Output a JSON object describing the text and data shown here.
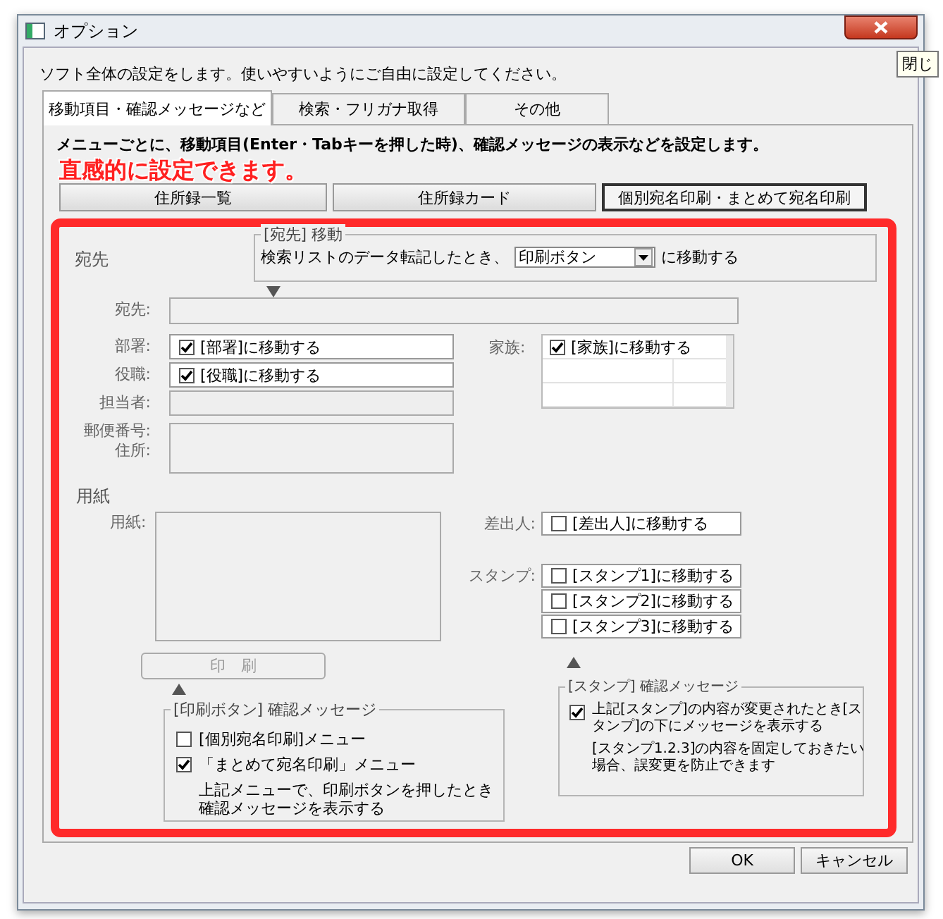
{
  "window": {
    "title": "オプション",
    "tooltip": "閉じ"
  },
  "intro": "ソフト全体の設定をします。使いやすいようにご自由に設定してください。",
  "tabs": [
    {
      "label": "移動項目・確認メッセージなど",
      "selected": true
    },
    {
      "label": "検索・フリガナ取得",
      "selected": false
    },
    {
      "label": "その他",
      "selected": false
    }
  ],
  "description": "メニューごとに、移動項目(Enter・Tabキーを押した時)、確認メッセージの表示などを設定します。",
  "annotation": "直感的に設定できます。",
  "menu_buttons": [
    {
      "label": "住所録一覧",
      "selected": false
    },
    {
      "label": "住所録カード",
      "selected": false
    },
    {
      "label": "個別宛名印刷・まとめて宛名印刷",
      "selected": true
    }
  ],
  "address": {
    "heading": "宛先",
    "move_group": {
      "legend": "[宛先] 移動",
      "prefix": "検索リストのデータ転記したとき、",
      "dropdown": "印刷ボタン",
      "suffix": "に移動する"
    },
    "fields": [
      {
        "labels": [
          "宛先:"
        ],
        "kind": "wide"
      },
      {
        "labels": [
          "部署:"
        ],
        "kind": "check",
        "checked": true,
        "text": "[部署]に移動する"
      },
      {
        "labels": [
          "役職:"
        ],
        "kind": "check",
        "checked": true,
        "text": "[役職]に移動する"
      },
      {
        "labels": [
          "担当者:"
        ],
        "kind": "disabled"
      },
      {
        "labels": [
          "郵便番号:",
          "住所:"
        ],
        "kind": "area"
      }
    ],
    "family": {
      "label": "家族:",
      "checked": true,
      "text": "[家族]に移動する"
    }
  },
  "paper": {
    "heading": "用紙",
    "label": "用紙:",
    "sender": {
      "label": "差出人:",
      "checked": false,
      "text": "[差出人]に移動する"
    },
    "stamp_label": "スタンプ:",
    "stamps": [
      {
        "checked": false,
        "text": "[スタンプ1]に移動する"
      },
      {
        "checked": false,
        "text": "[スタンプ2]に移動する"
      },
      {
        "checked": false,
        "text": "[スタンプ3]に移動する"
      }
    ],
    "print_button": {
      "label": "印　刷",
      "disabled": true
    }
  },
  "print_confirm": {
    "legend": "[印刷ボタン] 確認メッセージ",
    "options": [
      {
        "checked": false,
        "text": "[個別宛名印刷]メニュー"
      },
      {
        "checked": true,
        "text": "「まとめて宛名印刷」メニュー"
      }
    ],
    "note": "上記メニューで、印刷ボタンを押したとき確認メッセージを表示する"
  },
  "stamp_confirm": {
    "legend": "[スタンプ] 確認メッセージ",
    "option": {
      "checked": true,
      "text": "上記[スタンプ]の内容が変更されたとき[スタンプ]の下にメッセージを表示する"
    },
    "note": "[スタンプ1.2.3]の内容を固定しておきたい場合、誤変更を防止できます"
  },
  "buttons": [
    "OK",
    "キャンセル"
  ]
}
